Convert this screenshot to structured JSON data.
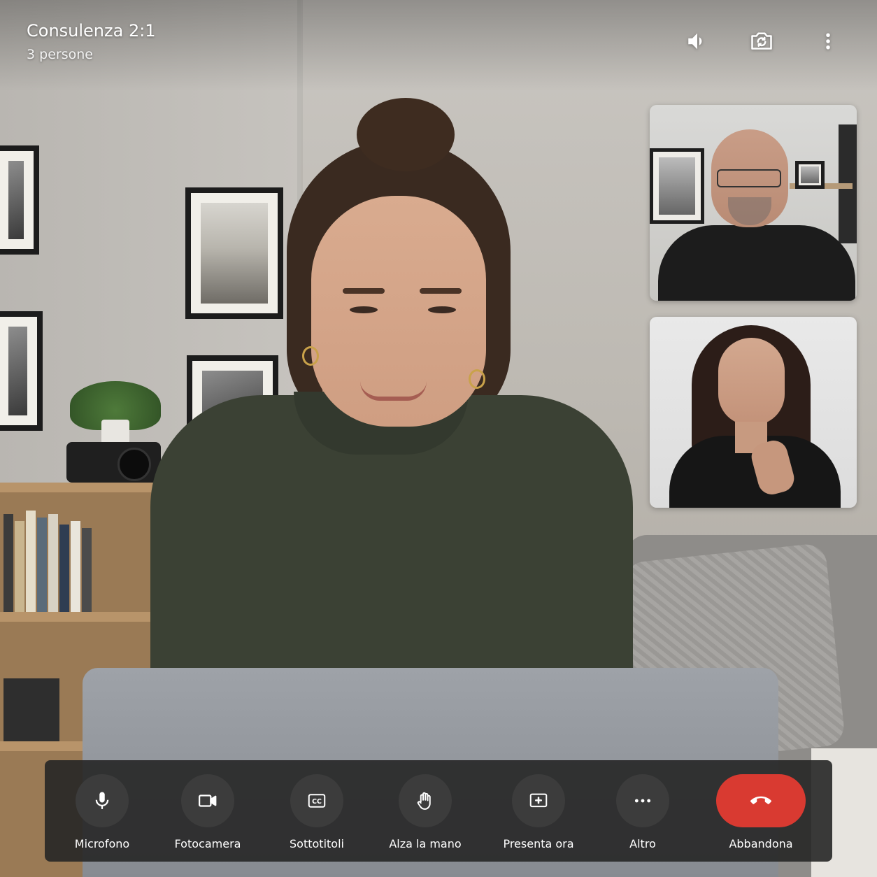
{
  "header": {
    "title": "Consulenza 2:1",
    "participants": "3 persone",
    "icons": [
      "speaker-icon",
      "switch-camera-icon",
      "more-vert-icon"
    ]
  },
  "participants_tiles": [
    {
      "name": "participant-tile-1"
    },
    {
      "name": "participant-tile-2"
    }
  ],
  "controls": {
    "microphone": "Microfono",
    "camera": "Fotocamera",
    "captions": "Sottotitoli",
    "raise_hand": "Alza la mano",
    "present": "Presenta ora",
    "more": "Altro",
    "leave": "Abbandona"
  },
  "colors": {
    "leave_button": "#d93a31",
    "control_button": "#3c3c3c",
    "control_bar": "#262626"
  }
}
